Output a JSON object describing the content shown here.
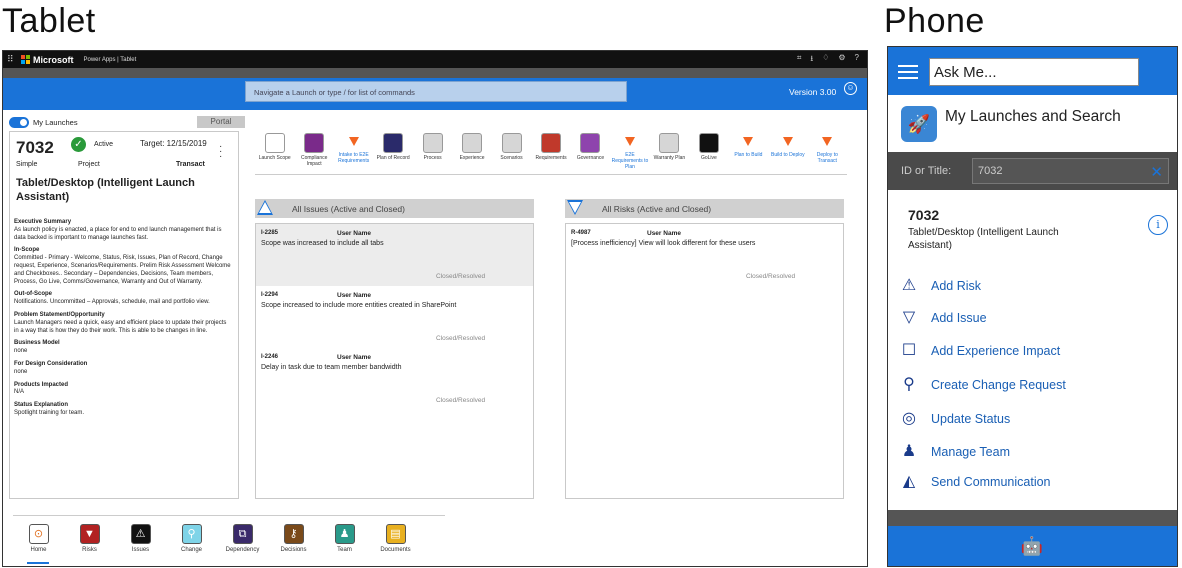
{
  "headings": {
    "tablet": "Tablet",
    "phone": "Phone"
  },
  "tablet": {
    "topbar": {
      "brand": "Microsoft",
      "crumb": "Power Apps | Tablet",
      "icons": [
        "connect-icon",
        "download-icon",
        "bell-icon",
        "settings-icon",
        "help-icon"
      ],
      "icon_glyphs": [
        "⌗",
        "⭳",
        "♢",
        "⚙",
        "?"
      ]
    },
    "search_placeholder": "Navigate a Launch or type / for list of commands",
    "version": "Version 3.00",
    "my_launches_label": "My Launches",
    "portal_label": "Portal",
    "launch": {
      "id": "7032",
      "status": "Active",
      "target": "Target: 12/15/2019",
      "size": "Simple",
      "type": "Project",
      "stage": "Transact",
      "title": "Tablet/Desktop (Intelligent Launch Assistant)"
    },
    "sections": [
      {
        "heading": "Executive Summary",
        "body": "As launch policy is enacted, a place for end to end launch management that is data backed is important to manage launches fast."
      },
      {
        "heading": "In-Scope",
        "body": "Committed - Primary - Welcome, Status, Risk, Issues, Plan of Record, Change request, Experience, Scenarios/Requirements. Prelim Risk Assessment Welcome and Checkboxes.. Secondary – Dependencies, Decisions, Team members, Process, Go Live, Comms/Governance, Warranty and Out of Warranty."
      },
      {
        "heading": "Out-of-Scope",
        "body": "Notifications. Uncommitted – Approvals, schedule, mail and portfolio view."
      },
      {
        "heading": "Problem Statement/Opportunity",
        "body": "Launch Managers need a quick, easy and efficient place to update their projects in a way that is how they do their work. This is able to be changes in line."
      },
      {
        "heading": "Business Model",
        "body": "none"
      },
      {
        "heading": "For Design Consideration",
        "body": "none"
      },
      {
        "heading": "Products Impacted",
        "body": "N/A"
      },
      {
        "heading": "Status Explanation",
        "body": "Spotlight training for team."
      }
    ],
    "stages": [
      {
        "label": "Launch Scope",
        "kind": "box",
        "color": "#ffffff"
      },
      {
        "label": "Compliance Impact",
        "kind": "box",
        "color": "#7a2a8a"
      },
      {
        "label": "Intake to E2E Requirements",
        "kind": "tri"
      },
      {
        "label": "Plan of Record",
        "kind": "box",
        "color": "#2a2a6a"
      },
      {
        "label": "Process",
        "kind": "box",
        "color": "#d6d6d6"
      },
      {
        "label": "Experience",
        "kind": "box",
        "color": "#d6d6d6"
      },
      {
        "label": "Scenarios",
        "kind": "box",
        "color": "#d6d6d6"
      },
      {
        "label": "Requirements",
        "kind": "box",
        "color": "#c0392b"
      },
      {
        "label": "Governance",
        "kind": "box",
        "color": "#8e44ad"
      },
      {
        "label": "E2E Requirements to Plan",
        "kind": "tri"
      },
      {
        "label": "Warranty Plan",
        "kind": "box",
        "color": "#d6d6d6"
      },
      {
        "label": "GoLive",
        "kind": "box",
        "color": "#111111"
      },
      {
        "label": "Plan to Build",
        "kind": "tri"
      },
      {
        "label": "Build to Deploy",
        "kind": "tri"
      },
      {
        "label": "Deploy to Transact",
        "kind": "tri"
      }
    ],
    "issues": {
      "header": "All Issues (Active and Closed)",
      "items": [
        {
          "id": "I-2285",
          "user": "User Name",
          "desc": "Scope was increased to include all tabs",
          "status": "Closed/Resolved"
        },
        {
          "id": "I-2294",
          "user": "User Name",
          "desc": "Scope increased to include more entities created in SharePoint",
          "status": "Closed/Resolved"
        },
        {
          "id": "I-2246",
          "user": "User Name",
          "desc": "Delay in task due to team member bandwidth",
          "status": "Closed/Resolved"
        }
      ]
    },
    "risks": {
      "header": "All Risks (Active and Closed)",
      "items": [
        {
          "id": "R-4987",
          "user": "User Name",
          "desc": "[Process inefficiency] View will look different for these users",
          "status": "Closed/Resolved"
        }
      ]
    },
    "bottom_nav": [
      {
        "label": "Home",
        "color": "#ffffff",
        "glyph": "⊙"
      },
      {
        "label": "Risks",
        "color": "#b22222",
        "glyph": "▼"
      },
      {
        "label": "Issues",
        "color": "#111111",
        "glyph": "⚠"
      },
      {
        "label": "Change",
        "color": "#7fd4e8",
        "glyph": "⚲"
      },
      {
        "label": "Dependency",
        "color": "#3a2a6a",
        "glyph": "⧉"
      },
      {
        "label": "Decisions",
        "color": "#7a4a1a",
        "glyph": "⚷"
      },
      {
        "label": "Team",
        "color": "#2a9a8a",
        "glyph": "♟"
      },
      {
        "label": "Documents",
        "color": "#e8b020",
        "glyph": "▤"
      }
    ]
  },
  "phone": {
    "ask_placeholder": "Ask Me...",
    "title": "My Launches and Search",
    "filter_label": "ID  or Title:",
    "filter_value": "7032",
    "launch_id": "7032",
    "launch_name": "Tablet/Desktop (Intelligent Launch Assistant)",
    "actions": [
      {
        "label": "Add Risk",
        "glyph": "⚠"
      },
      {
        "label": "Add Issue",
        "glyph": "▽"
      },
      {
        "label": "Add Experience Impact",
        "glyph": "☐"
      },
      {
        "label": "Create Change Request",
        "glyph": "⚲"
      },
      {
        "label": "Update Status",
        "glyph": "◎"
      },
      {
        "label": "Manage Team",
        "glyph": "♟"
      },
      {
        "label": "Send Communication",
        "glyph": "◭"
      }
    ]
  }
}
